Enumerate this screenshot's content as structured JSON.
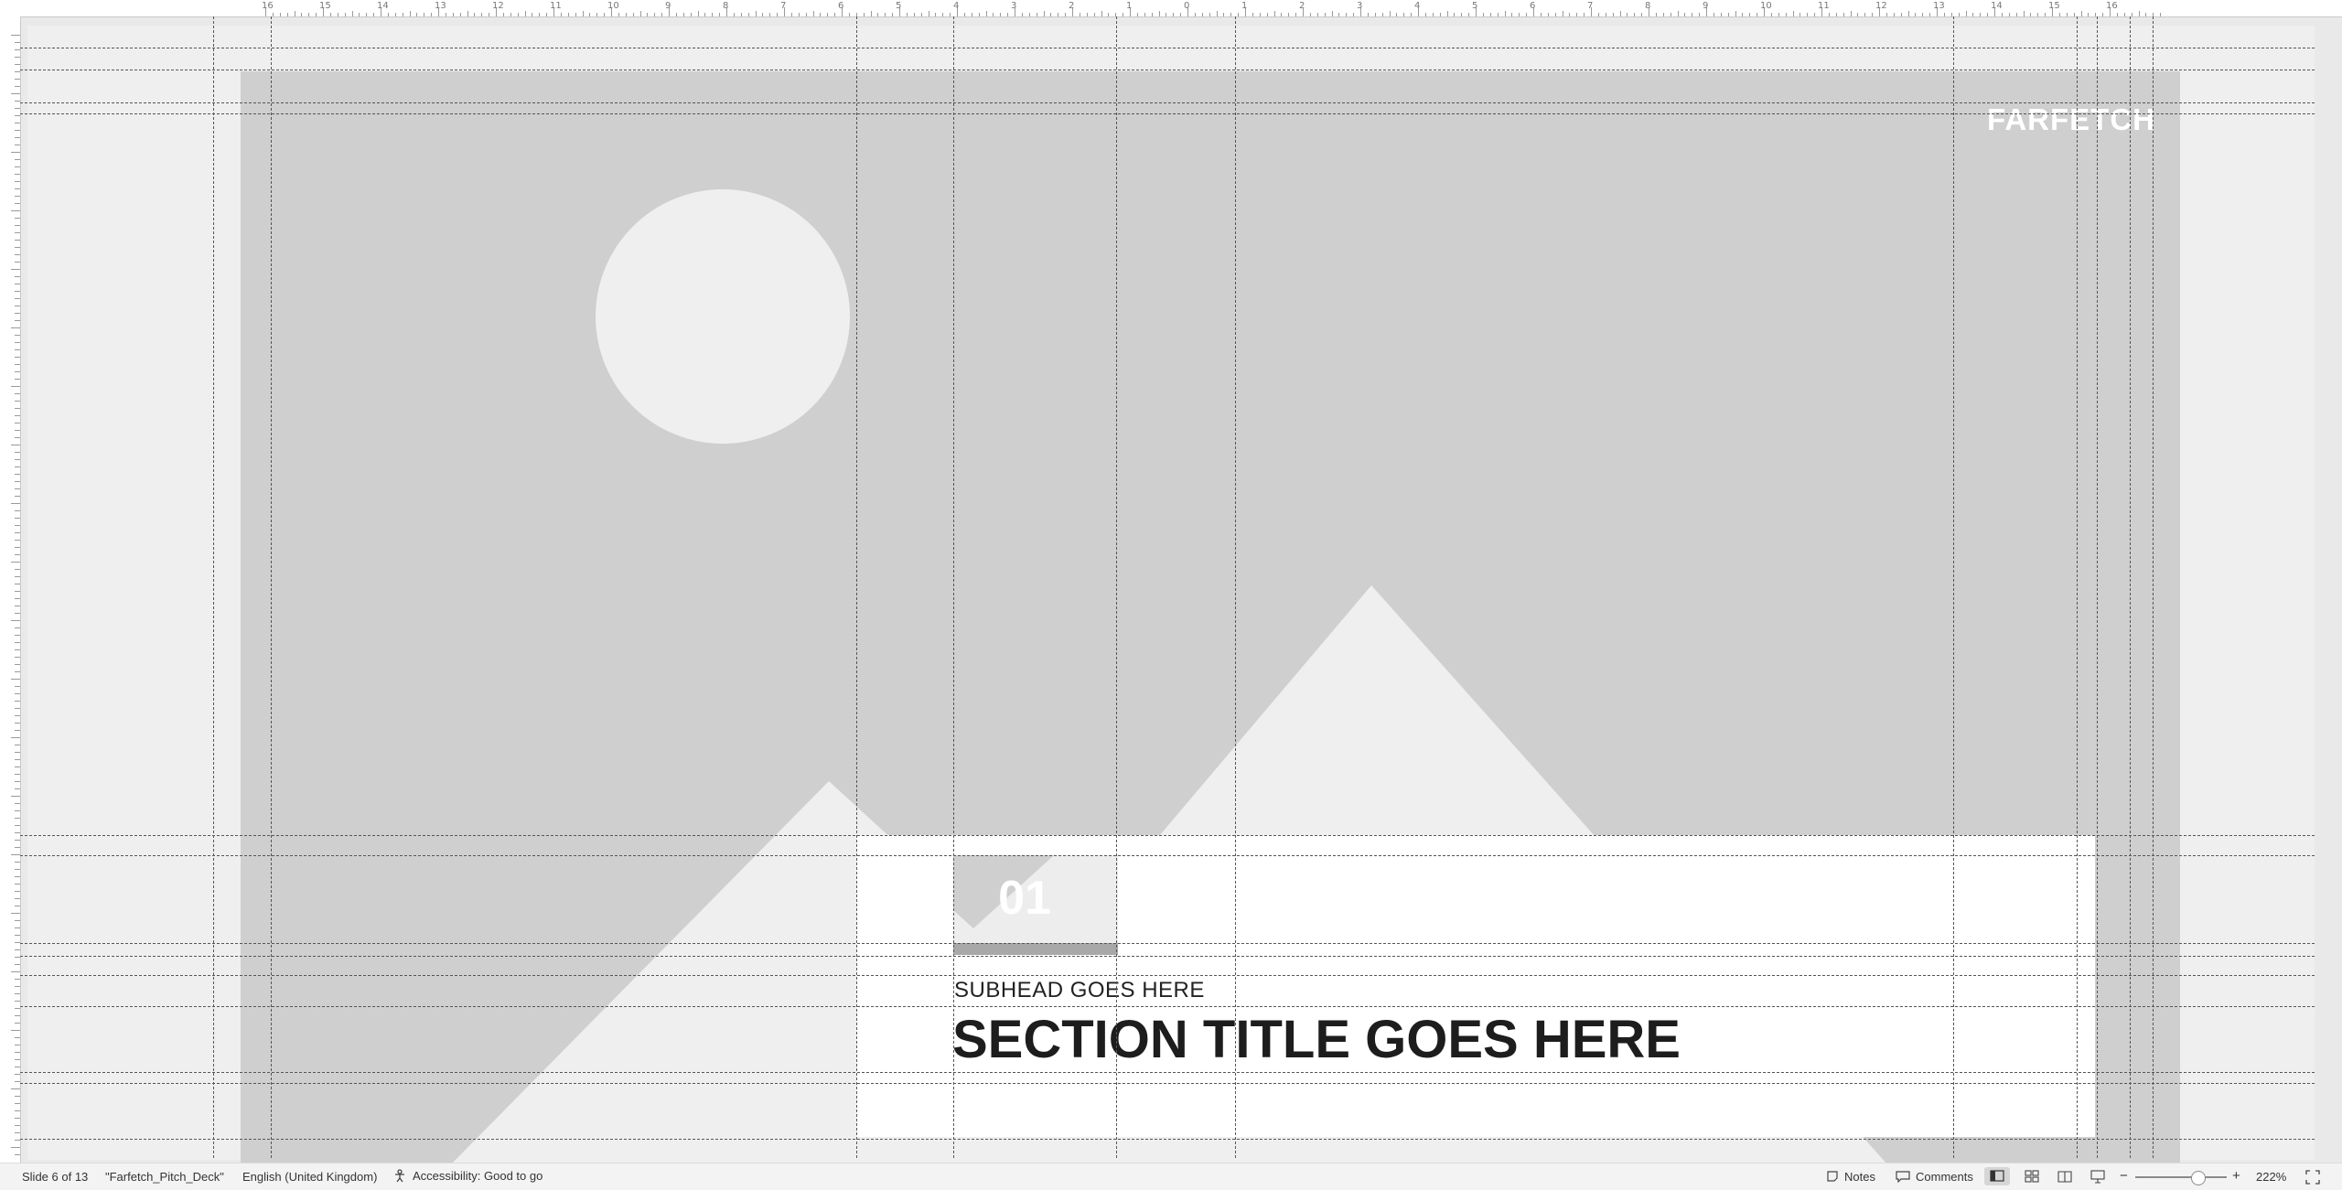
{
  "ruler": {
    "top_labels": [
      "16",
      "15",
      "14",
      "13",
      "12",
      "11",
      "10",
      "9",
      "8",
      "7",
      "6",
      "5",
      "4",
      "3",
      "2",
      "1",
      "0",
      "1",
      "2",
      "3",
      "4",
      "5",
      "6",
      "7",
      "8",
      "9",
      "10",
      "11",
      "12",
      "13",
      "14",
      "15",
      "16"
    ]
  },
  "slide": {
    "logo": "FARFETCH",
    "number": "01",
    "subhead": "SUBHEAD GOES HERE",
    "section_title": "SECTION TITLE GOES HERE"
  },
  "status_bar": {
    "slide_info": "Slide 6 of 13",
    "file_name": "\"Farfetch_Pitch_Deck\"",
    "language": "English (United Kingdom)",
    "accessibility": "Accessibility: Good to go",
    "notes_label": "Notes",
    "comments_label": "Comments",
    "zoom_minus": "−",
    "zoom_plus": "+",
    "zoom_level": "222%"
  },
  "colors": {
    "slide_placeholder": "#cfcfcf",
    "shape_light": "#efefef",
    "panel": "#ffffff",
    "title_text": "#1d1d1d"
  }
}
